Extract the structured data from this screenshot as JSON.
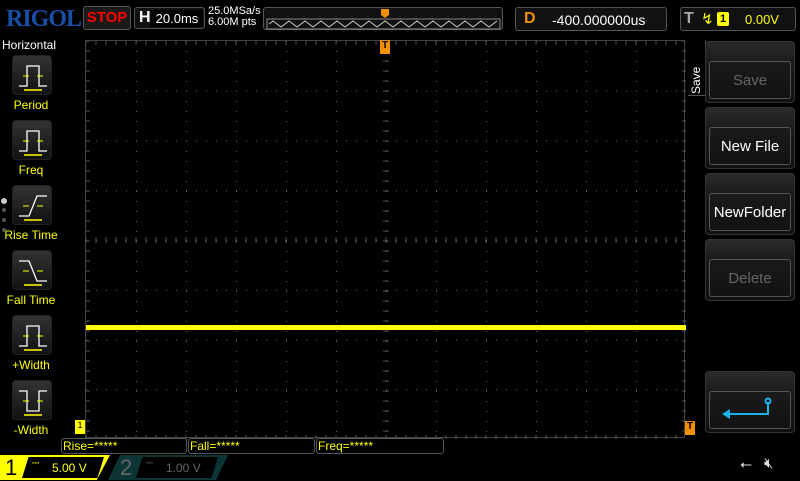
{
  "brand": "RIGOL",
  "run_state": "STOP",
  "horizontal": {
    "label": "H",
    "timebase": "20.0ms",
    "sample_rate": "25.0MSa/s",
    "memory_depth": "6.00M pts"
  },
  "delay": {
    "label": "D",
    "value": "-400.000000us"
  },
  "trigger": {
    "label": "T",
    "slope_icon": "rising-edge-icon",
    "source": "1",
    "level": "0.00V"
  },
  "left_menu": {
    "title": "Horizontal",
    "items": [
      {
        "label": "Period",
        "icon": "period-icon"
      },
      {
        "label": "Freq",
        "icon": "frequency-icon"
      },
      {
        "label": "Rise Time",
        "icon": "rise-time-icon"
      },
      {
        "label": "Fall Time",
        "icon": "fall-time-icon"
      },
      {
        "label": "+Width",
        "icon": "positive-width-icon"
      },
      {
        "label": "-Width",
        "icon": "negative-width-icon"
      }
    ]
  },
  "right_menu": {
    "title": "Save",
    "buttons": [
      {
        "label": "Save",
        "enabled": false
      },
      {
        "label": "New File",
        "enabled": true
      },
      {
        "label": "NewFolder",
        "enabled": true
      },
      {
        "label": "Delete",
        "enabled": false
      },
      {
        "label": "",
        "icon": "return-icon",
        "enabled": true
      }
    ]
  },
  "measurements": [
    "Rise=*****",
    "Fall=*****",
    "Freq=*****"
  ],
  "channels": [
    {
      "num": "1",
      "scale": "5.00 V",
      "active": true,
      "color": "#ffff00"
    },
    {
      "num": "2",
      "scale": "1.00 V",
      "active": false,
      "color": "#0a7c7c"
    }
  ],
  "colors": {
    "ch1": "#ffff00",
    "trigger": "#f39000",
    "accent": "#1ab0e8"
  }
}
